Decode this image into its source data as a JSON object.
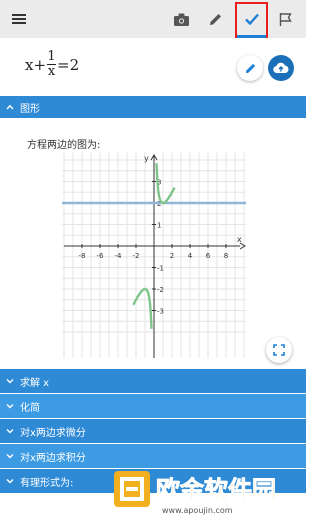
{
  "toolbar": {
    "icons": [
      "menu-icon",
      "camera-icon",
      "pencil-icon",
      "check-icon",
      "flag-icon"
    ],
    "active_tab": "check",
    "accent_color": "#1e7fd6",
    "highlight_color": "#e81e1e"
  },
  "equation": {
    "lhs_var": "x+",
    "frac_num": "1",
    "frac_den": "x",
    "rhs": "=2",
    "edit_icon": "pencil-icon",
    "upload_icon": "cloud-upload-icon"
  },
  "sections": {
    "graph": {
      "label": "图形",
      "caption": "方程两边的图为:"
    },
    "items": [
      {
        "label": "求解 x"
      },
      {
        "label": "化简"
      },
      {
        "label": "对x两边求微分"
      },
      {
        "label": "对x两边求积分"
      },
      {
        "label": "有理形式为:"
      }
    ]
  },
  "plot": {
    "x_axis_label": "x",
    "y_axis_label": "y",
    "x_ticks": [
      "-8",
      "-6",
      "-4",
      "-2",
      "2",
      "4",
      "6",
      "8"
    ],
    "y_ticks": [
      "3",
      "2",
      "1",
      "-1",
      "-2",
      "-3"
    ],
    "line_y2_color": "#8fb6d6",
    "curve_color": "#7fc58a"
  },
  "chart_data": {
    "type": "line",
    "title": "",
    "xlabel": "x",
    "ylabel": "y",
    "xlim": [
      -10,
      10
    ],
    "ylim": [
      -3.8,
      3.8
    ],
    "grid": true,
    "series": [
      {
        "name": "",
        "function": "x + 1/x"
      },
      {
        "name": "",
        "function": "2"
      }
    ]
  },
  "watermark": {
    "text": "欧金软件园",
    "url": "www.apoujin.com"
  }
}
